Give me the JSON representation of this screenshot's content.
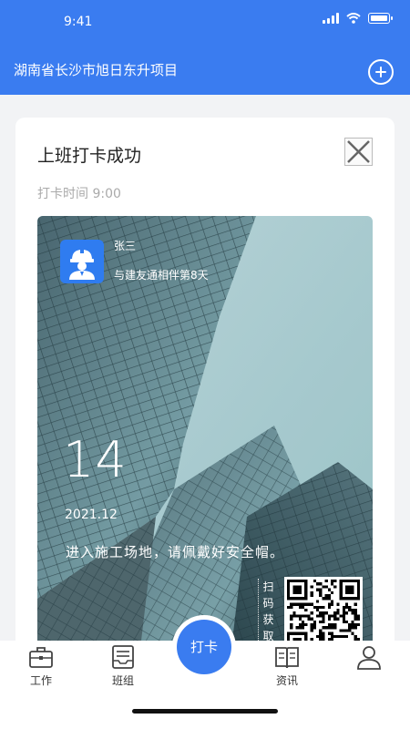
{
  "status_bar": {
    "time": "9:41"
  },
  "header": {
    "project_name": "湖南省长沙市旭日东升项目"
  },
  "card": {
    "title": "上班打卡成功",
    "checkin_time": "打卡时间 9:00",
    "poster": {
      "user_name": "张三",
      "days_together": "与建友通相伴第8天",
      "day": "14",
      "year_month": "2021.12",
      "message": "进入施工场地，请佩戴好安全帽。",
      "qr_label": "扫码获取"
    }
  },
  "bottom_nav": {
    "items": [
      {
        "label": "工作",
        "icon": "briefcase-icon"
      },
      {
        "label": "班组",
        "icon": "team-tray-icon"
      },
      {
        "label": "资讯",
        "icon": "book-icon"
      },
      {
        "label": "",
        "icon": "profile-icon"
      }
    ],
    "center_button": "打卡"
  },
  "colors": {
    "accent": "#3a7cf0"
  }
}
